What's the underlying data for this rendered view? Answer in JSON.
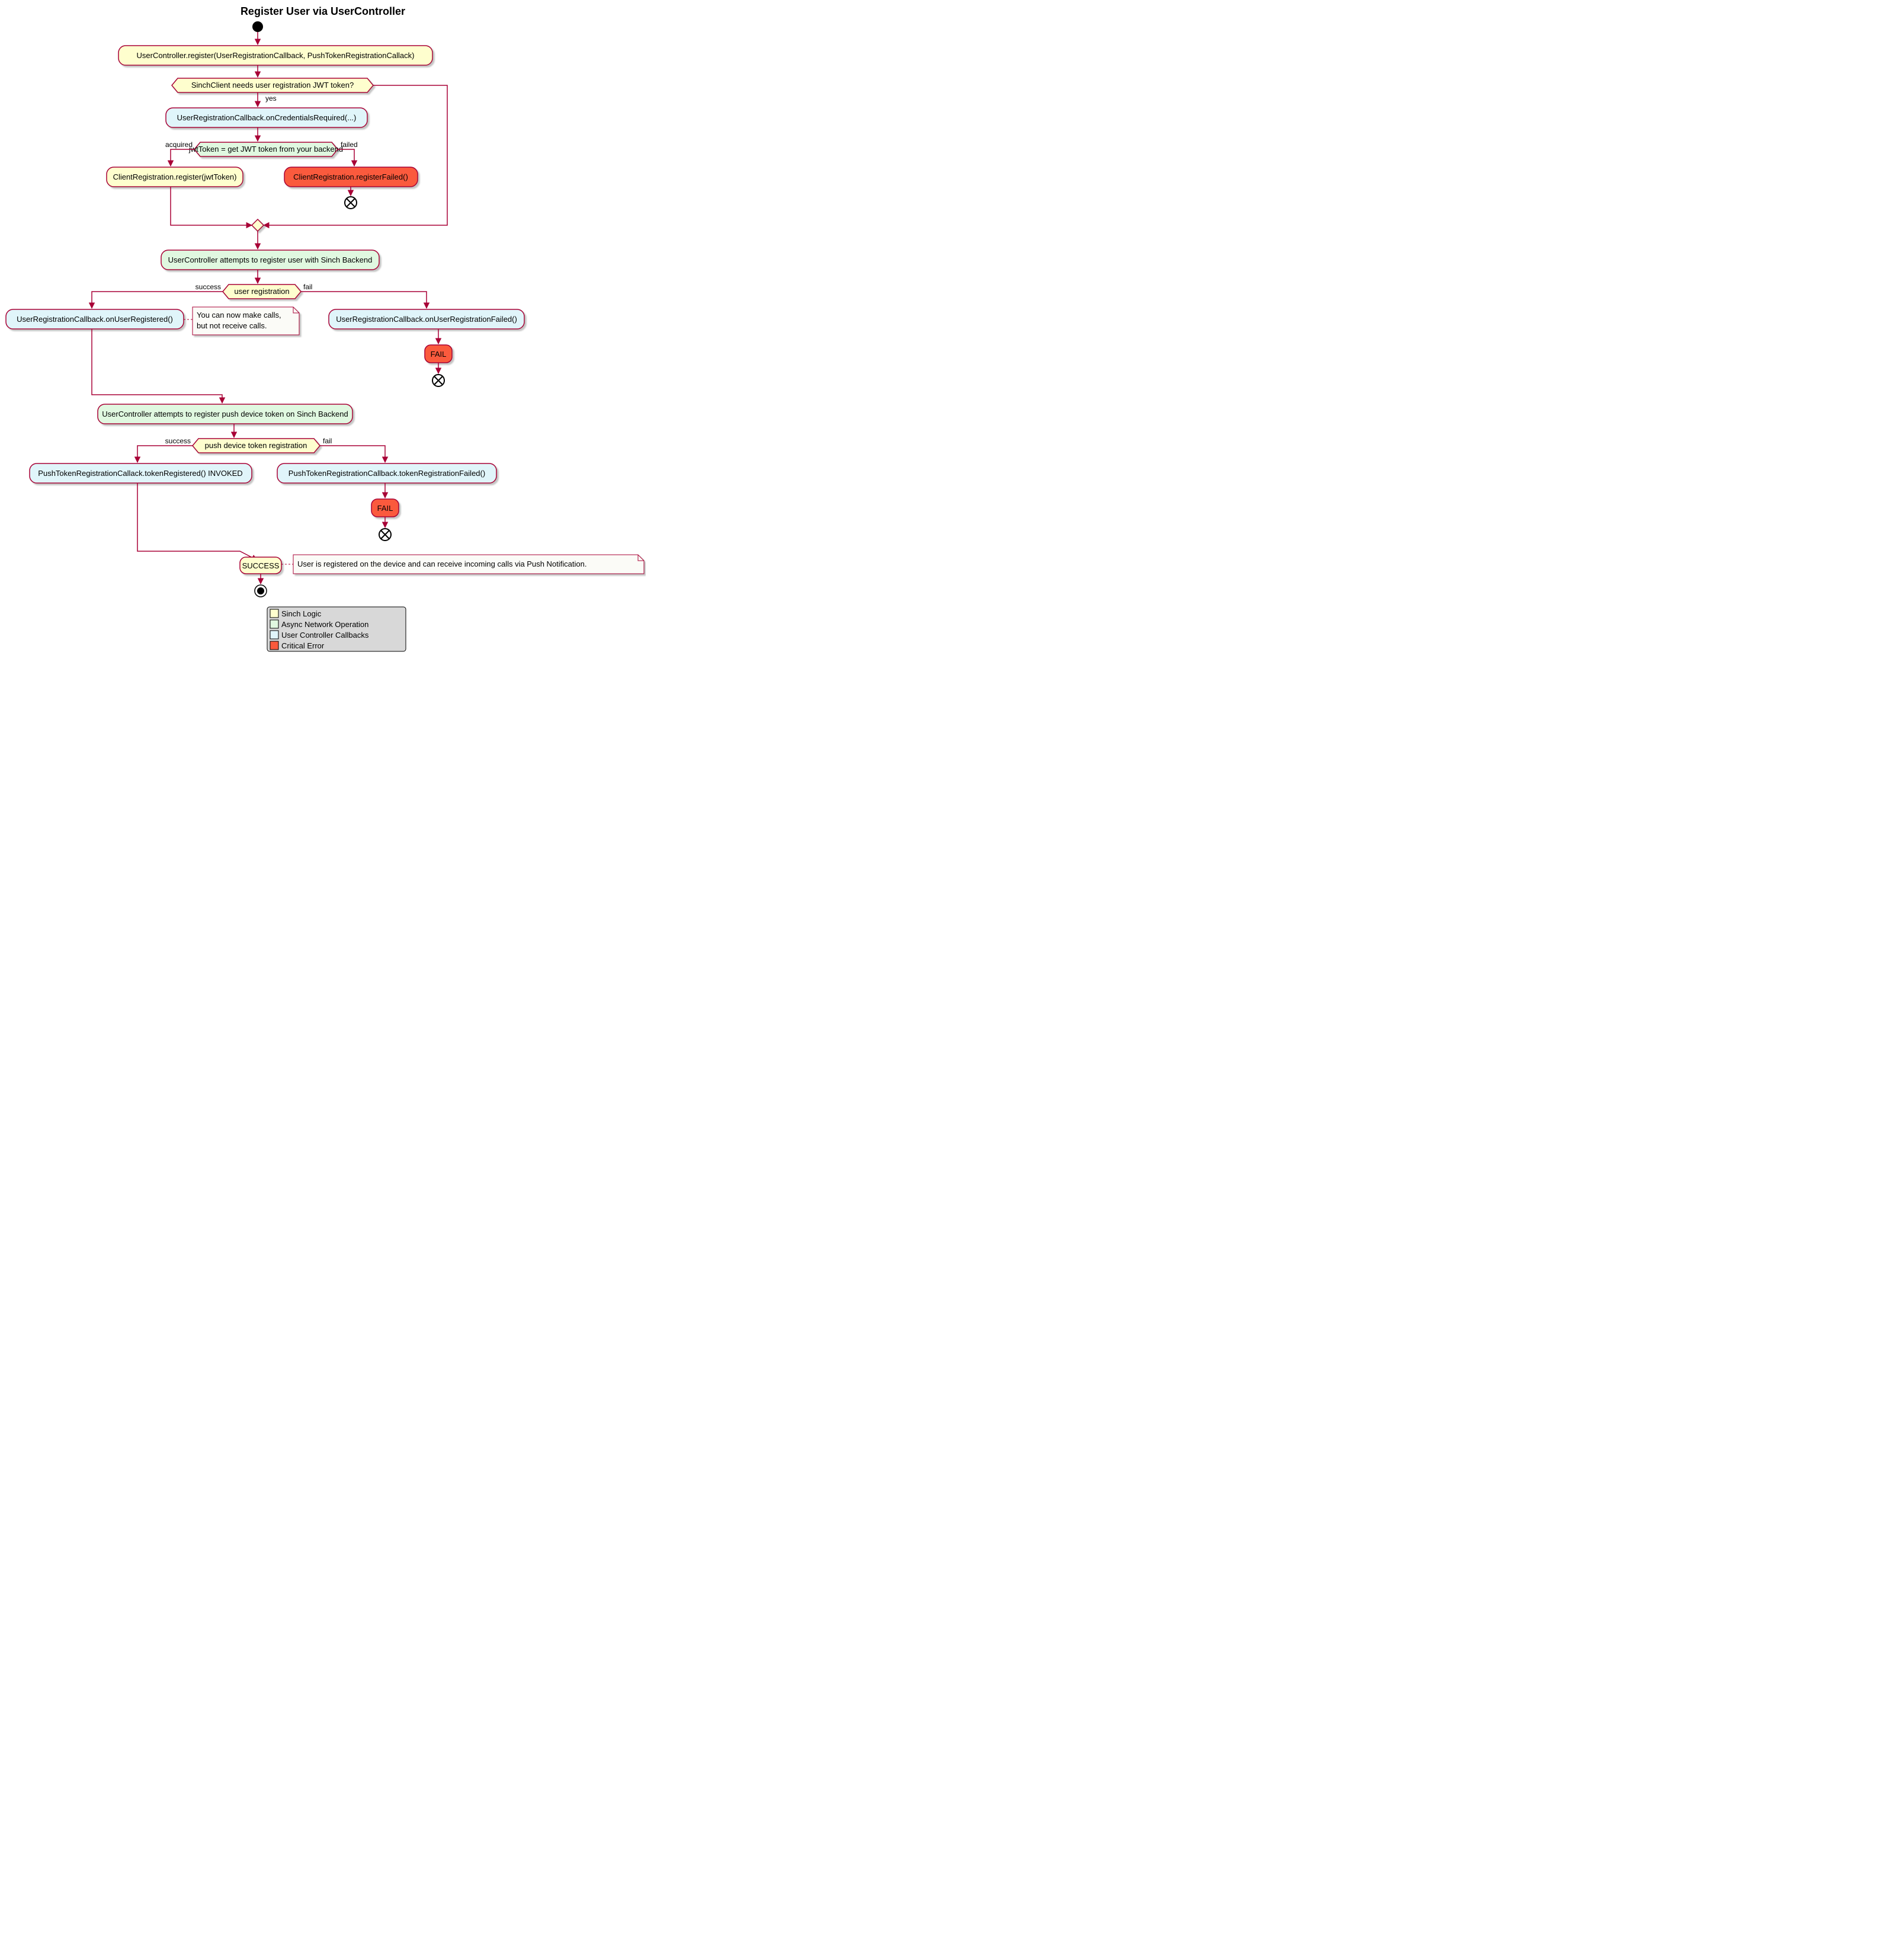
{
  "title": "Register User via UserController",
  "nodes": {
    "n1": "UserController.register(UserRegistrationCallback, PushTokenRegistrationCallack)",
    "d1": "SinchClient needs user registration JWT token?",
    "n2": "UserRegistrationCallback.onCredentialsRequired(...)",
    "d2": "jwtToken = get JWT token from your backend",
    "n3": "ClientRegistration.register(jwtToken)",
    "n4": "ClientRegistration.registerFailed()",
    "n5": "UserController attempts to register user with Sinch Backend",
    "d3": "user registration",
    "n6": "UserRegistrationCallback.onUserRegistered()",
    "n7": "UserRegistrationCallback.onUserRegistrationFailed()",
    "n8": "FAIL",
    "n9": "UserController attempts to register push device token on Sinch Backend",
    "d4": "push device token registration",
    "n10": "PushTokenRegistrationCallack.tokenRegistered() INVOKED",
    "n11": "PushTokenRegistrationCallback.tokenRegistrationFailed()",
    "n12": "FAIL",
    "n13": "SUCCESS"
  },
  "edges": {
    "yes": "yes",
    "acquired": "acquired",
    "failed": "failed",
    "success1": "success",
    "fail1": "fail",
    "success2": "success",
    "fail2": "fail"
  },
  "notes": {
    "note1": "You can now make calls, but not receive calls.",
    "note2": "User is registered on the device and can receive incoming calls via Push Notification."
  },
  "legend": {
    "l1": "Sinch Logic",
    "l2": "Async Network Operation",
    "l3": "User Controller Callbacks",
    "l4": "Critical Error"
  },
  "colors": {
    "sinch": "#FEFECE",
    "async": "#E0F8E0",
    "callback": "#E0F5FA",
    "error": "#FA5A3C",
    "border": "#A80036",
    "shadow": "#c0c0c0",
    "legendbg": "#d8d8d8",
    "notebg": "#FBFBF7"
  }
}
